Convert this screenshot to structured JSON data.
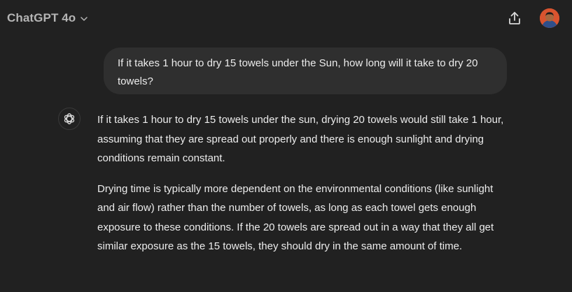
{
  "header": {
    "model_name": "ChatGPT 4o",
    "model_chevron_icon": "chevron-down-icon",
    "share_icon": "share-icon",
    "avatar_icon": "user-avatar"
  },
  "conversation": {
    "user_message": "If it takes 1 hour to dry 15 towels under the Sun, how long will it take to dry 20 towels?",
    "assistant_icon": "openai-logo-icon",
    "assistant_paragraphs": [
      "If it takes 1 hour to dry 15 towels under the sun, drying 20 towels would still take 1 hour, assuming that they are spread out properly and there is enough sunlight and drying conditions remain constant.",
      "Drying time is typically more dependent on the environmental conditions (like sunlight and air flow) rather than the number of towels, as long as each towel gets enough exposure to these conditions. If the 20 towels are spread out in a way that they all get similar exposure as the 15 towels, they should dry in the same amount of time."
    ]
  },
  "colors": {
    "background": "#212121",
    "user_bubble": "#2f2f2f",
    "text": "#ececec",
    "muted_text": "#b4b4b4"
  }
}
